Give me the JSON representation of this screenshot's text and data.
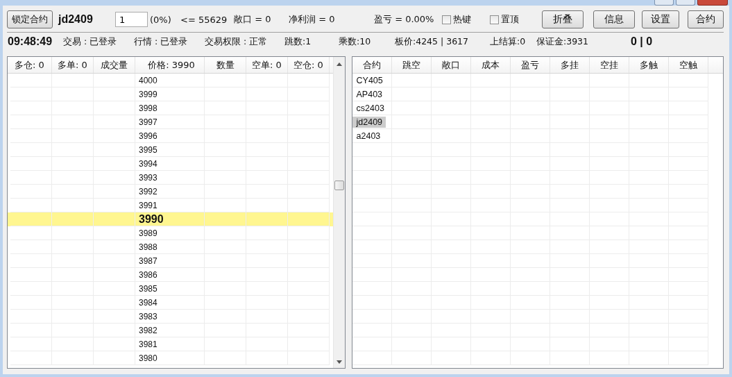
{
  "toolbar": {
    "lock_button": "锁定合约",
    "symbol": "jd2409",
    "quantity": "1",
    "percent": "(0%)",
    "limit": "<= 55629",
    "exposure": "敞口 = 0",
    "net_profit": "净利润 = 0",
    "pnl": "盈亏 = 0.00%",
    "checkboxes": [
      {
        "label": "热键",
        "checked": false
      },
      {
        "label": "置顶",
        "checked": false
      }
    ],
    "buttons": [
      "折叠",
      "信息",
      "设置",
      "合约"
    ]
  },
  "status": {
    "time": "09:48:49",
    "items": [
      "交易 : 已登录",
      "行情 : 已登录",
      "交易权限 : 正常",
      "跳数:1",
      "乘数:10",
      "板价:4245 | 3617",
      "上结算:0",
      "保证金:3931"
    ],
    "counter": "0 | 0"
  },
  "order_book": {
    "columns": [
      "多仓: 0",
      "多单: 0",
      "成交量",
      "价格: 3990",
      "数量",
      "空单: 0",
      "空仓: 0"
    ],
    "rows": [
      {
        "price": "4000",
        "selected": false
      },
      {
        "price": "3999",
        "selected": false
      },
      {
        "price": "3998",
        "selected": false
      },
      {
        "price": "3997",
        "selected": false
      },
      {
        "price": "3996",
        "selected": false
      },
      {
        "price": "3995",
        "selected": false
      },
      {
        "price": "3994",
        "selected": false
      },
      {
        "price": "3993",
        "selected": false
      },
      {
        "price": "3992",
        "selected": false
      },
      {
        "price": "3991",
        "selected": false
      },
      {
        "price": "3990",
        "selected": true
      },
      {
        "price": "3989",
        "selected": false
      },
      {
        "price": "3988",
        "selected": false
      },
      {
        "price": "3987",
        "selected": false
      },
      {
        "price": "3986",
        "selected": false
      },
      {
        "price": "3985",
        "selected": false
      },
      {
        "price": "3984",
        "selected": false
      },
      {
        "price": "3983",
        "selected": false
      },
      {
        "price": "3982",
        "selected": false
      },
      {
        "price": "3981",
        "selected": false
      },
      {
        "price": "3980",
        "selected": false
      }
    ]
  },
  "contracts": {
    "columns": [
      "合约",
      "跳空",
      "敞口",
      "成本",
      "盈亏",
      "多挂",
      "空挂",
      "多触",
      "空触"
    ],
    "rows": [
      {
        "contract": "CY405",
        "selected": false
      },
      {
        "contract": "AP403",
        "selected": false
      },
      {
        "contract": "cs2403",
        "selected": false
      },
      {
        "contract": "jd2409",
        "selected": true
      },
      {
        "contract": "a2403",
        "selected": false
      }
    ]
  }
}
